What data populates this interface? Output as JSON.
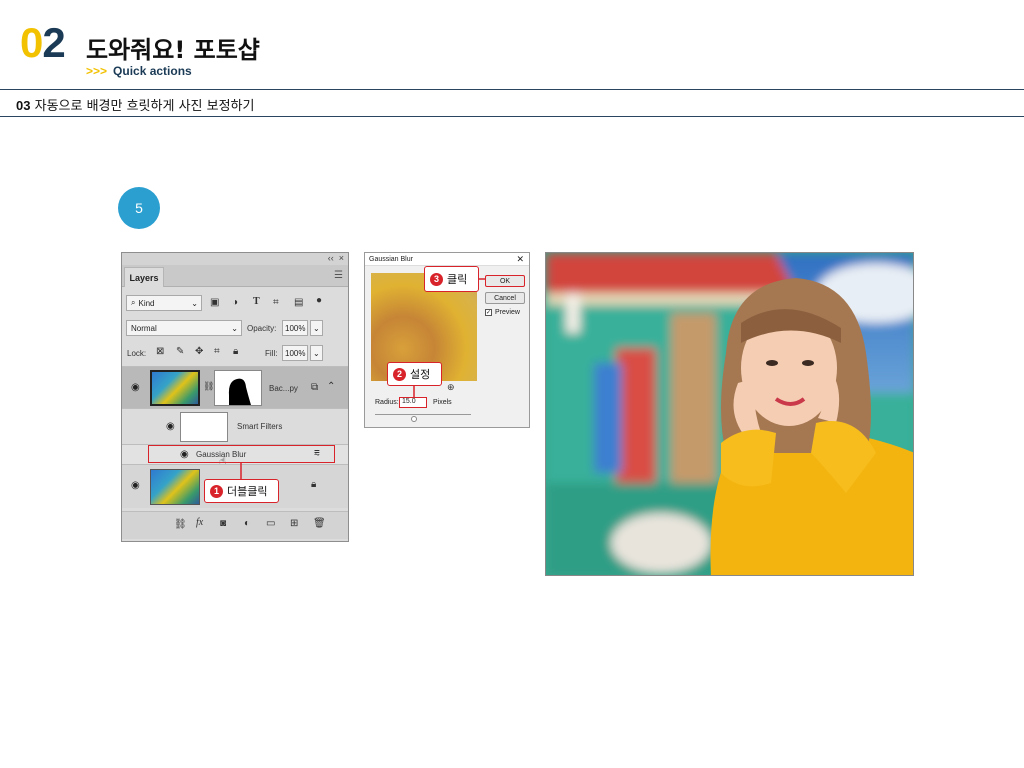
{
  "header": {
    "chapter_num_first": "0",
    "chapter_num_second": "2",
    "chapter_title": "도와줘요! 포토샵",
    "subtitle_arrows": ">>>",
    "subtitle": "Quick actions"
  },
  "section": {
    "number": "03",
    "title": "자동으로 배경만 흐릿하게 사진 보정하기"
  },
  "step": "5",
  "layers_panel": {
    "collapse_glyph": "‹‹",
    "close_glyph": "×",
    "tab_label": "Layers",
    "filter_kind": "Kind",
    "blend_mode": "Normal",
    "opacity_label": "Opacity:",
    "opacity_value": "100%",
    "lock_label": "Lock:",
    "fill_label": "Fill:",
    "fill_value": "100%",
    "layer_top_name": "Bac...py",
    "smart_filters_label": "Smart Filters",
    "gaussian_blur_label": "Gaussian Blur",
    "fx_label": "fx"
  },
  "gaussian_dialog": {
    "title": "Gaussian Blur",
    "ok_label": "OK",
    "cancel_label": "Cancel",
    "preview_label": "Preview",
    "radius_label": "Radius:",
    "radius_value": "15.0",
    "units_label": "Pixels"
  },
  "callouts": {
    "c1_num": "1",
    "c1_text": "더블클릭",
    "c2_num": "2",
    "c2_text": "설정",
    "c3_num": "3",
    "c3_text": "클릭"
  },
  "colors": {
    "accent_yellow": "#f2c100",
    "navy": "#1a3a55",
    "step_blue": "#2a9fd0",
    "callout_red": "#d8232a"
  }
}
